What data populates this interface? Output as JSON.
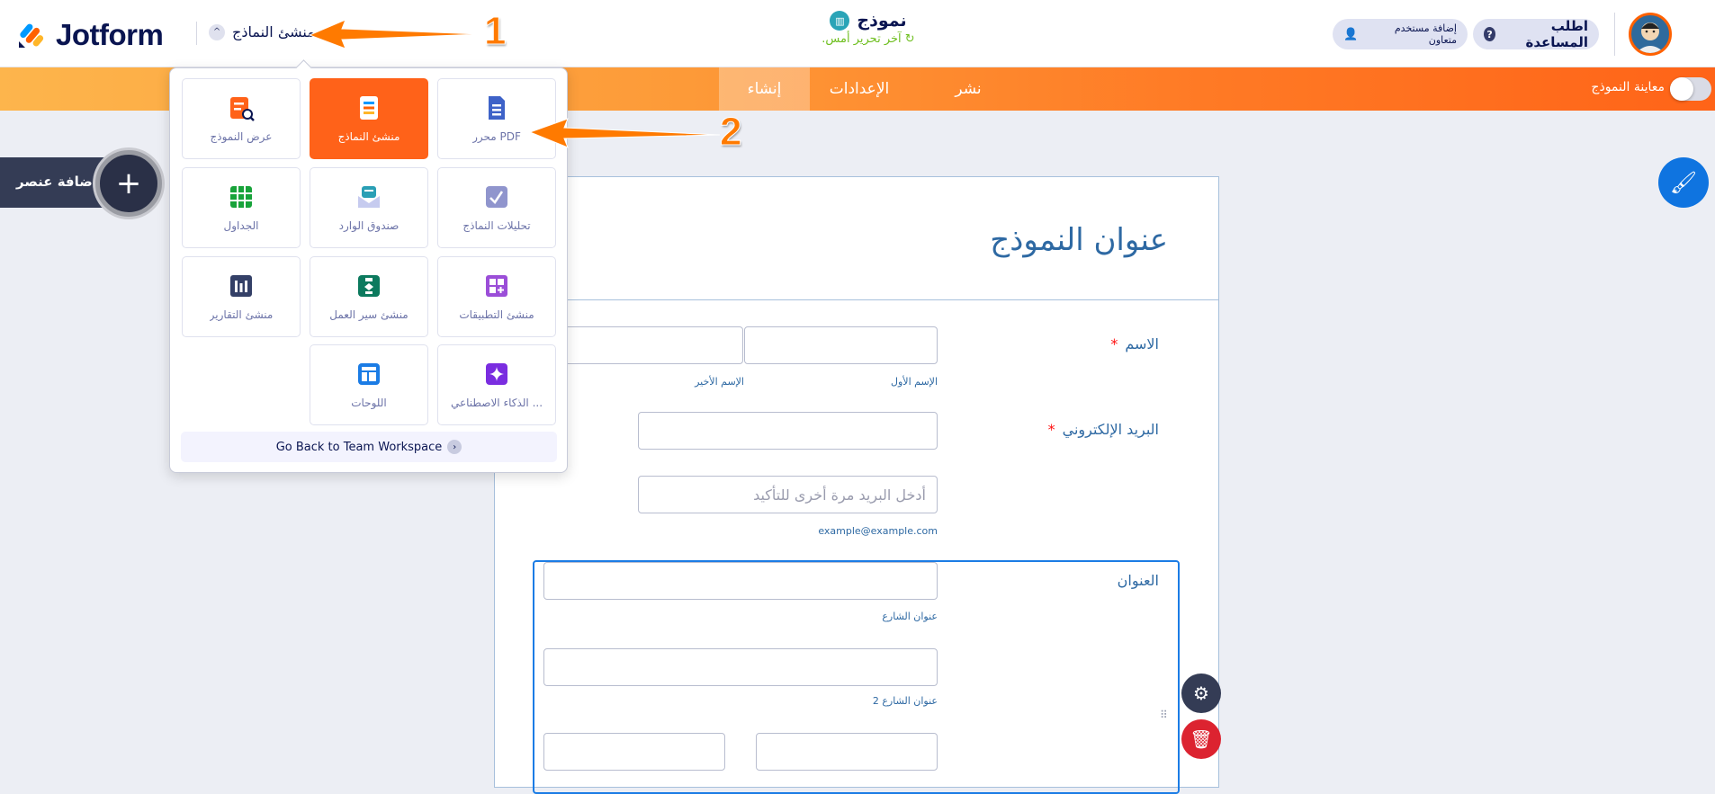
{
  "header": {
    "logo": "Jotform",
    "builder_switch": "منشئ النماذج",
    "form_name": "نموذج",
    "last_edited": "آخر تحرير أمس.",
    "collab_button": "إضافة مستخدم متعاون",
    "help_button": "اطلب المساعدة"
  },
  "nav": {
    "tabs": [
      {
        "label": "إنشاء",
        "active": true
      },
      {
        "label": "الإعدادات"
      },
      {
        "label": "نشر"
      }
    ],
    "preview_label": "معاينة النموذج",
    "preview_on": false
  },
  "sidebar": {
    "add_element": "إضافة عنصر"
  },
  "annotations": [
    "1",
    "2"
  ],
  "dropdown": {
    "tiles": [
      {
        "label": "PDF محرر",
        "icon": "pdf-icon",
        "color": "#3e62c8"
      },
      {
        "label": "منشئ النماذج",
        "icon": "form-builder-icon",
        "color": "#ffffff",
        "active": true
      },
      {
        "label": "عرض النموذج",
        "icon": "form-view-icon",
        "color": "#ff6219"
      },
      {
        "label": "تحليلات النماذج",
        "icon": "analytics-icon",
        "color": "#9095cd"
      },
      {
        "label": "صندوق الوارد",
        "icon": "inbox-icon",
        "color": "#2a9fb5"
      },
      {
        "label": "الجداول",
        "icon": "tables-icon",
        "color": "#18a33a"
      },
      {
        "label": "منشئ التطبيقات",
        "icon": "apps-icon",
        "color": "#9b4ed8"
      },
      {
        "label": "منشئ سير العمل",
        "icon": "workflow-icon",
        "color": "#0c7a5e"
      },
      {
        "label": "منشئ التقارير",
        "icon": "reports-icon",
        "color": "#344067"
      },
      {
        "label": "... الذكاء الاصطناعي",
        "icon": "ai-icon",
        "color": "#7a2de0"
      },
      {
        "label": "اللوحات",
        "icon": "boards-icon",
        "color": "#1b7ce5"
      }
    ],
    "go_back": "Go Back to Team Workspace"
  },
  "form": {
    "title": "عنوان النموذج",
    "name_label": "الاسم",
    "first_name": "الإسم الأول",
    "last_name": "الإسم الأخير",
    "email_label": "البريد الإلكتروني",
    "email_confirm_placeholder": "أدخل البريد مرة أخرى للتأكيد",
    "email_example": "example@example.com",
    "address_label": "العنوان",
    "street": "عنوان الشارع",
    "street2": "عنوان الشارع 2",
    "required_mark": "*"
  }
}
